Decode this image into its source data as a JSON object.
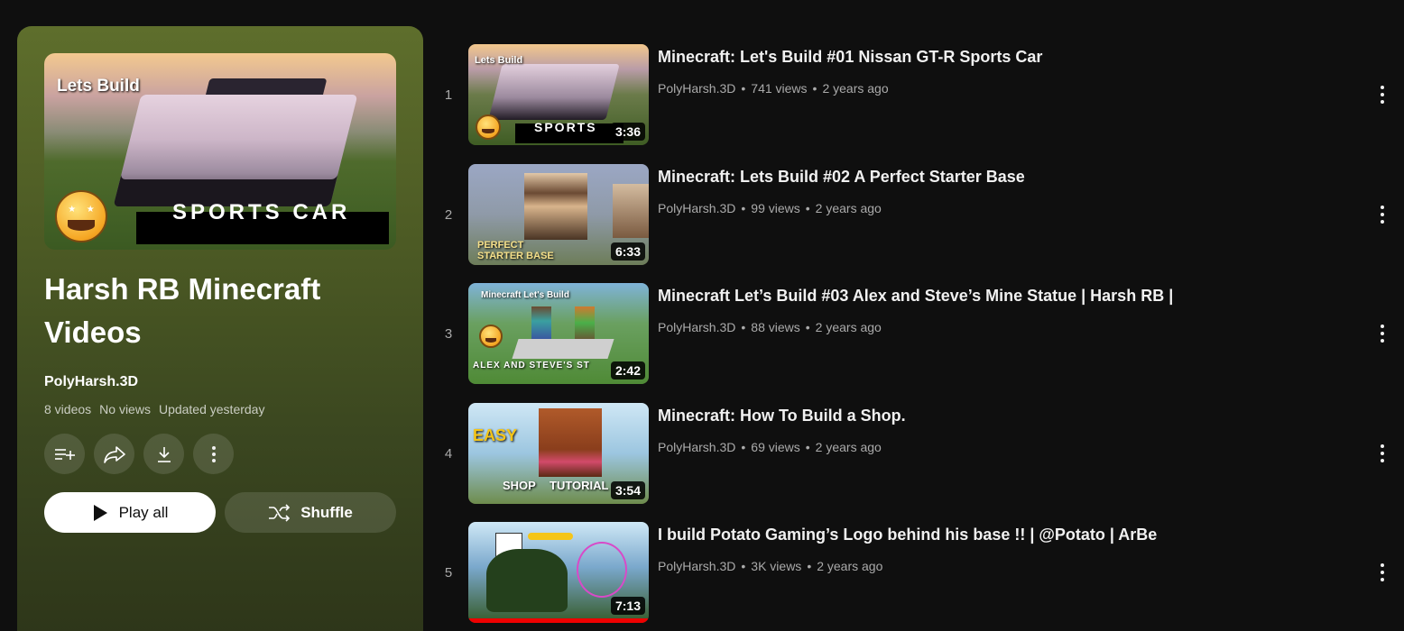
{
  "playlist": {
    "hero": {
      "top_text": "Lets Build",
      "bottom_text": "SPORTS CAR"
    },
    "title": "Harsh RB Minecraft Videos",
    "owner": "PolyHarsh.3D",
    "meta": [
      "8 videos",
      "No views",
      "Updated yesterday"
    ],
    "actions": {
      "add": "add-to-queue-icon",
      "share": "share-icon",
      "download": "download-icon",
      "more": "more-vert-icon"
    },
    "play_all_label": "Play all",
    "shuffle_label": "Shuffle"
  },
  "videos": [
    {
      "index": "1",
      "title": "Minecraft: Let's Build #01 Nissan GT-R Sports Car",
      "channel": "PolyHarsh.3D",
      "views": "741 views",
      "age": "2 years ago",
      "duration": "3:36",
      "thumb_text": "Lets Build",
      "thumb_text2": "SPORTS"
    },
    {
      "index": "2",
      "title": "Minecraft: Lets Build #02 A Perfect Starter Base",
      "channel": "PolyHarsh.3D",
      "views": "99 views",
      "age": "2 years ago",
      "duration": "6:33",
      "thumb_text": "PERFECT",
      "thumb_text2": "STARTER BASE"
    },
    {
      "index": "3",
      "title": "Minecraft Let’s Build #03 Alex and Steve’s Mine Statue | Harsh RB |",
      "channel": "PolyHarsh.3D",
      "views": "88 views",
      "age": "2 years ago",
      "duration": "2:42",
      "thumb_text": "Minecraft Let's Build",
      "thumb_text2": "ALEX AND STEVE'S ST"
    },
    {
      "index": "4",
      "title": "Minecraft: How To Build a Shop.",
      "channel": "PolyHarsh.3D",
      "views": "69 views",
      "age": "2 years ago",
      "duration": "3:54",
      "thumb_text": "EASY",
      "thumb_text2": "SHOP",
      "thumb_text3": "TUTORIAL"
    },
    {
      "index": "5",
      "title": "I build Potato Gaming’s Logo behind his base !! | @Potato | ArBe",
      "channel": "PolyHarsh.3D",
      "views": "3K views",
      "age": "2 years ago",
      "duration": "7:13"
    }
  ],
  "colors": {
    "background": "#0f0f0f",
    "panel_top": "#5e6e2c",
    "panel_bottom": "#2d3519",
    "meta_text": "#aaaaaa"
  }
}
